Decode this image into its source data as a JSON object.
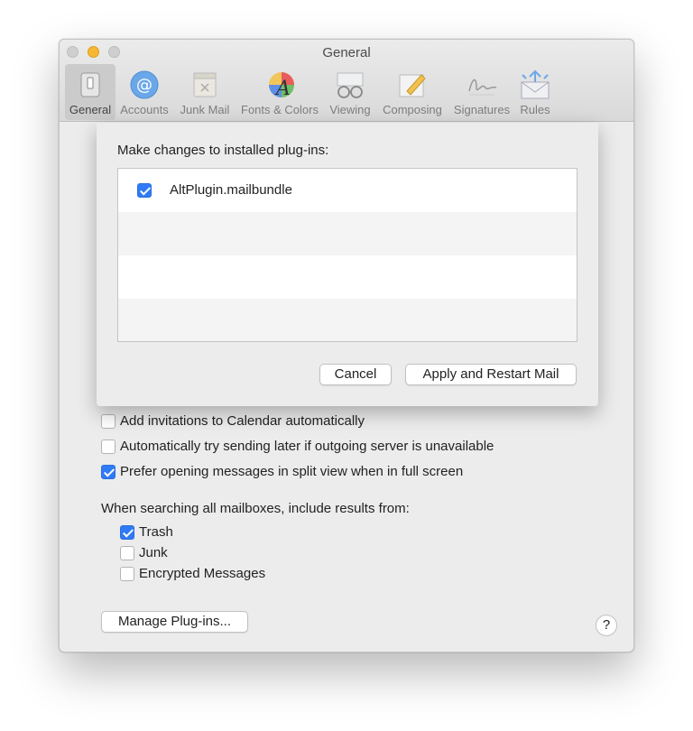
{
  "window": {
    "title": "General"
  },
  "tabs": [
    {
      "label": "General",
      "icon": "switch-icon"
    },
    {
      "label": "Accounts",
      "icon": "at-icon"
    },
    {
      "label": "Junk Mail",
      "icon": "junk-bin-icon"
    },
    {
      "label": "Fonts & Colors",
      "icon": "color-wheel-icon"
    },
    {
      "label": "Viewing",
      "icon": "glasses-icon"
    },
    {
      "label": "Composing",
      "icon": "pencil-icon"
    },
    {
      "label": "Signatures",
      "icon": "signature-icon"
    },
    {
      "label": "Rules",
      "icon": "rules-envelope-icon"
    }
  ],
  "sheet": {
    "label": "Make changes to installed plug-ins:",
    "plugins": [
      {
        "name": "AltPlugin.mailbundle",
        "checked": true
      }
    ],
    "cancel_label": "Cancel",
    "apply_label": "Apply and Restart Mail"
  },
  "options": [
    {
      "label": "Add invitations to Calendar automatically",
      "checked": false
    },
    {
      "label": "Automatically try sending later if outgoing server is unavailable",
      "checked": false
    },
    {
      "label": "Prefer opening messages in split view when in full screen",
      "checked": true
    }
  ],
  "search": {
    "heading": "When searching all mailboxes, include results from:",
    "items": [
      {
        "label": "Trash",
        "checked": true
      },
      {
        "label": "Junk",
        "checked": false
      },
      {
        "label": "Encrypted Messages",
        "checked": false
      }
    ]
  },
  "manage_label": "Manage Plug-ins...",
  "help_label": "?",
  "colors": {
    "accent": "#2f7bf5",
    "traffic_minimize": "#f7b733"
  }
}
